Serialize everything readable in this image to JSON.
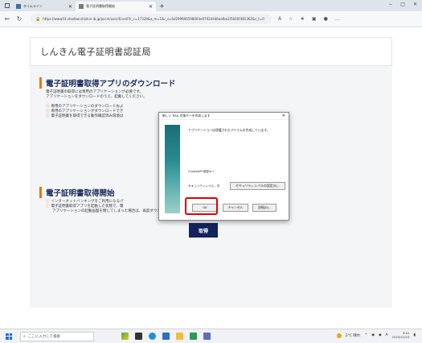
{
  "browser": {
    "tabs": [
      {
        "label": "タイムライン"
      },
      {
        "label": "電子証明書取得開始"
      }
    ],
    "new_tab": "+",
    "window_controls": [
      "−",
      "□",
      "✕"
    ],
    "address": "https://www03.shadow.shinkin-ib.jp/pccm/user/Enroll?k_c=17328&a_m=1&r_s=6d299906598004e97924446eafba1f5b00f481362&c_t=0"
  },
  "site": {
    "title": "しんきん電子証明書認証局"
  },
  "section1": {
    "title": "電子証明書取得アプリのダウンロード",
    "para1": "電子証明書の取得には専用のアプリケーションが必要です。",
    "para2": "アプリケーションをダウンロードのうえ、起動してください。",
    "note1": "専用のアプリケーションのダウンロードおよ",
    "note2": "専用のアプリケーションがダウンロードでき",
    "note3": "電子証明書を取得できる動作確認済み環境は"
  },
  "section2": {
    "title": "電子証明書取得開始",
    "note1": "インターネットバンキングをご利用になるパ",
    "note2": "電子証明書取得アプリを起動した状態で、電",
    "note3": "アプリケーションの起動画面を閉じてしまった場合は、再度ダウンロードのうえ、起動してください。",
    "button": "取得"
  },
  "dialog": {
    "title": "新しい RSA 交換キーを作成します",
    "close": "✕",
    "message": "アプリケーションは保護されたアイテムを作成しています。",
    "csp_label": "CryptoAPI 秘密キー",
    "security_level": "セキュリティレベル - 中",
    "security_button": "セキュリティ レベルの設定(S)...",
    "ok": "OK",
    "cancel": "キャンセル",
    "details": "詳細(D)..."
  },
  "taskbar": {
    "search_placeholder": "ここに入力して検索",
    "weather": "2°C 晴れ",
    "ime": "A",
    "time": "9:51",
    "date": "2023/12/15"
  },
  "colors": {
    "accent_bar": "#e07b10",
    "heading": "#1a2b5c",
    "primary_button": "#13235b",
    "highlight": "#e00000"
  }
}
